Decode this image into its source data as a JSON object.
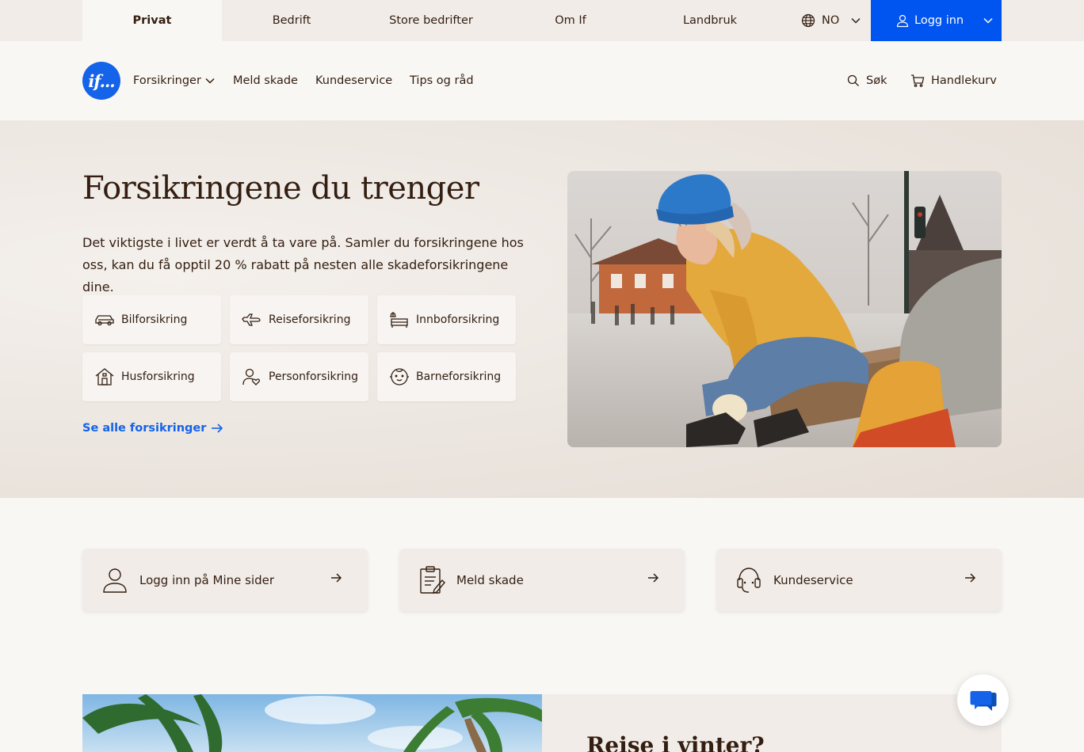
{
  "topbar": {
    "segments": [
      "Privat",
      "Bedrift",
      "Store bedrifter",
      "Om If",
      "Landbruk"
    ],
    "language": "NO",
    "login_label": "Logg inn"
  },
  "nav": {
    "logo_text": "if...",
    "links": [
      "Forsikringer",
      "Meld skade",
      "Kundeservice",
      "Tips og råd"
    ],
    "search_label": "Søk",
    "cart_label": "Handlekurv"
  },
  "hero": {
    "title": "Forsikringene du trenger",
    "text": "Det viktigste i livet er verdt å ta vare på. Samler du forsikringene hos oss, kan du få opptil 20 % rabatt på nesten alle skadeforsikringene dine.",
    "cards": [
      {
        "label": "Bilforsikring",
        "icon": "car-icon"
      },
      {
        "label": "Reiseforsikring",
        "icon": "plane-icon"
      },
      {
        "label": "Innboforsikring",
        "icon": "furniture-icon"
      },
      {
        "label": "Husforsikring",
        "icon": "house-icon"
      },
      {
        "label": "Personforsikring",
        "icon": "person-heart-icon"
      },
      {
        "label": "Barneforsikring",
        "icon": "baby-icon"
      }
    ],
    "see_all": "Se alle forsikringer"
  },
  "quick_actions": [
    {
      "label": "Logg inn på Mine sider",
      "icon": "user-icon"
    },
    {
      "label": "Meld skade",
      "icon": "clipboard-icon"
    },
    {
      "label": "Kundeservice",
      "icon": "headset-icon"
    }
  ],
  "promo": {
    "title": "Reise i vinter?"
  },
  "colors": {
    "brand_blue": "#0054f0",
    "text_brown": "#331e11",
    "background": "#f9f7f4"
  }
}
